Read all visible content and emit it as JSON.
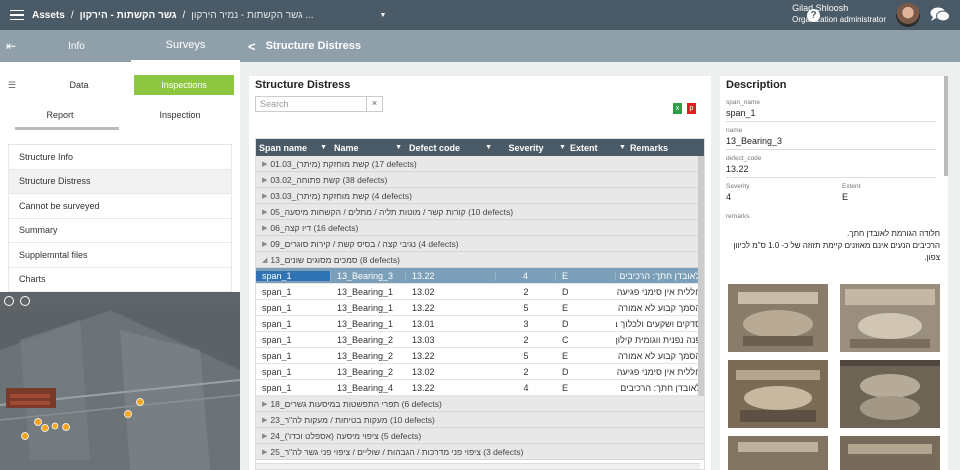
{
  "topbar": {
    "breadcrumb": [
      "Assets",
      "גשר הקשתות - הירקון",
      "גשר הקשתות - נמיר הירקון ..."
    ],
    "user_name": "Gilad Shloosh",
    "user_role": "Organization administrator"
  },
  "left": {
    "tabs": [
      "Info",
      "Surveys"
    ],
    "sub_tabs": [
      "Data",
      "Inspections"
    ],
    "sub_tabs2": [
      "Report",
      "Inspection"
    ],
    "menu": [
      "Structure Info",
      "Structure Distress",
      "Cannot be surveyed",
      "Summary",
      "Supplemntal files",
      "Charts"
    ]
  },
  "main": {
    "header_title": "Structure Distress",
    "panel_title": "Structure Distress",
    "search_placeholder": "Search",
    "columns": [
      "Span name",
      "Name",
      "Defect code",
      "Severity",
      "Extent",
      "Remarks"
    ],
    "groups_before": [
      "01.03_קשת מוחזקת (מיתר) (17 defects)",
      "03.02_קשת פתוחה (38 defects)",
      "03.03_קשת מוחזקת (מיתר) (4 defects)",
      "05_קורות קשר / מוטות תליה / מתלים / הקשחות מיסעה (10 defects)",
      "06_דיו קצה (16 defects)",
      "09_נגיבי קצה / בסיס קשת / קירות סוגרים (4 defects)"
    ],
    "open_group": "13_סמכים מסוגים שונים (8 defects)",
    "rows": [
      [
        "span_1",
        "13_Bearing_3",
        "13.22",
        "4",
        "E",
        "לאובדן חתך: הרכיבים"
      ],
      [
        "span_1",
        "13_Bearing_1",
        "13.02",
        "2",
        "D",
        "חללית אין סימני פגיעה"
      ],
      [
        "span_1",
        "13_Bearing_1",
        "13.22",
        "5",
        "E",
        "הסמך קבוע לא אמורה"
      ],
      [
        "span_1",
        "13_Bearing_1",
        "13.01",
        "3",
        "D",
        "סדקים ושקעים ולכלוך בחלקו"
      ],
      [
        "span_1",
        "13_Bearing_2",
        "13.03",
        "2",
        "C",
        "פנה נפנית ווגומית קילוף"
      ],
      [
        "span_1",
        "13_Bearing_2",
        "13.22",
        "5",
        "E",
        "הסמך קבוע לא אמורה"
      ],
      [
        "span_1",
        "13_Bearing_2",
        "13.02",
        "2",
        "D",
        "חללית אין סימני פגיעה"
      ],
      [
        "span_1",
        "13_Bearing_4",
        "13.22",
        "4",
        "E",
        "לאובדן חתך: הרכיבים"
      ]
    ],
    "groups_after": [
      "18_תפרי התפשטות במיסעות גשרים (6 defects)",
      "23_מעקות בטיחות / מעקות לה\"ר (10 defects)",
      "24_ציפוי מיסעה (אספלט וכדו') (5 defects)",
      "25_ציפוי פני מדרכות / הגבהות / שוליים / ציפוי פני גשר לה\"ר (3 defects)"
    ]
  },
  "desc": {
    "title": "Description",
    "span_name_label": "span_name",
    "span_name": "span_1",
    "name_label": "name",
    "name": "13_Bearing_3",
    "defect_code_label": "defect_code",
    "defect_code": "13.22",
    "severity_label": "Severity",
    "severity": "4",
    "extent_label": "Extent",
    "extent": "E",
    "remarks_label": "remarks",
    "remarks_line1": "חלודה הגורמת לאובדן חתך.",
    "remarks_line2": "הרכיבים הנעים אינם מאוזנים קיימת תזוזה של כ- 1.0 ס\"מ לכיוון צפון."
  }
}
